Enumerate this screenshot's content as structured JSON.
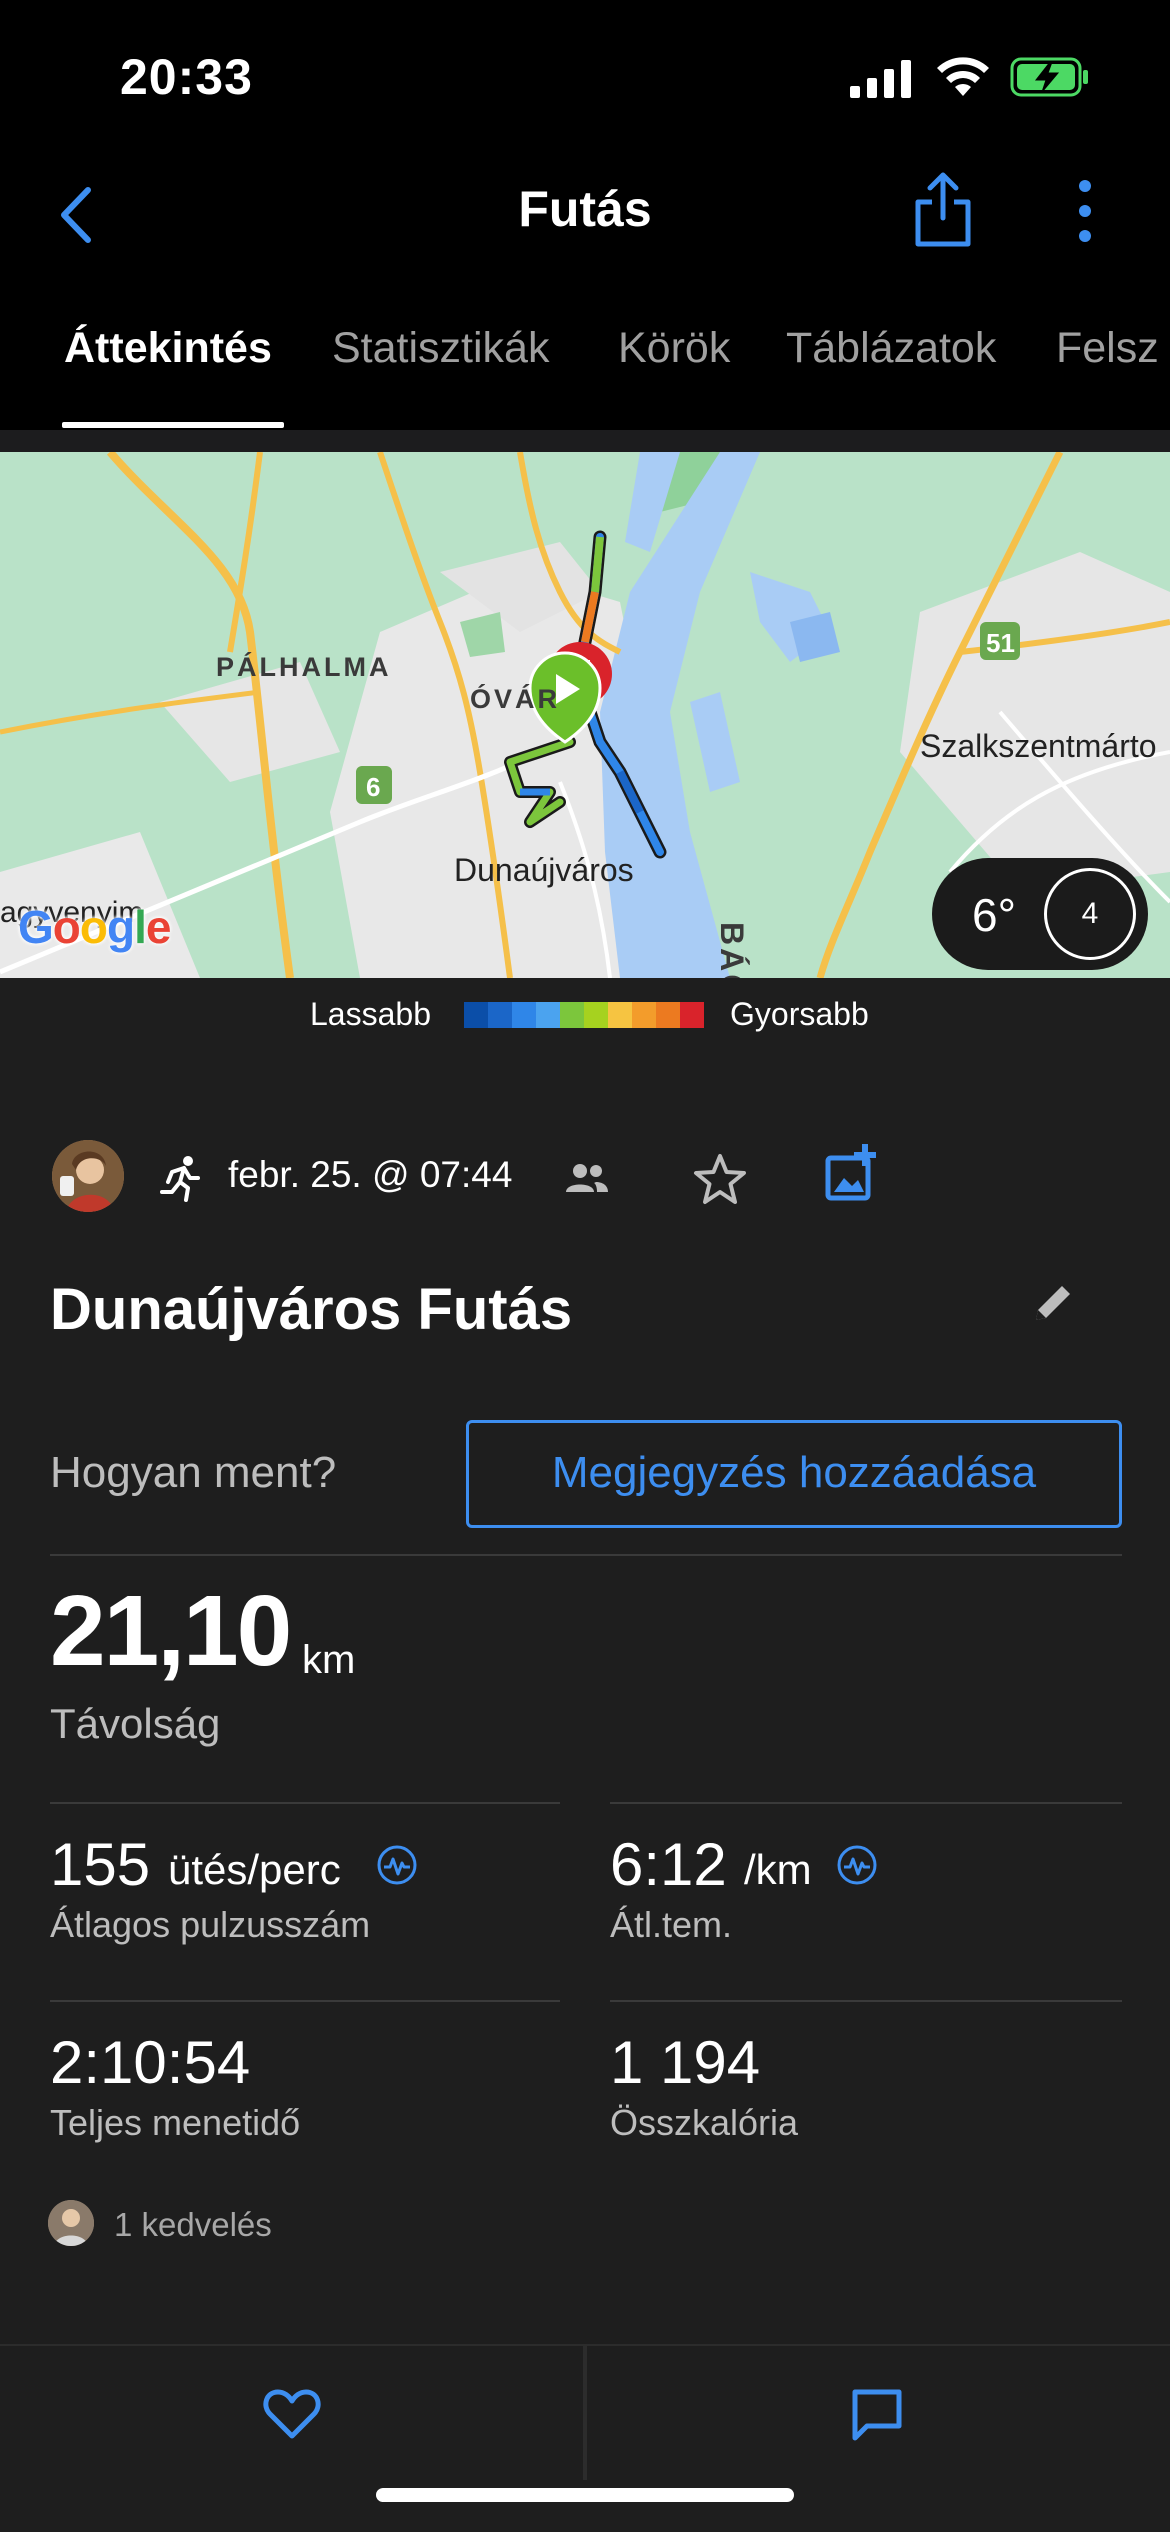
{
  "status_bar": {
    "time": "20:33"
  },
  "nav": {
    "title": "Futás"
  },
  "tabs": [
    {
      "label": "Áttekintés",
      "active": true
    },
    {
      "label": "Statisztikák"
    },
    {
      "label": "Körök"
    },
    {
      "label": "Táblázatok"
    },
    {
      "label": "Felsz"
    }
  ],
  "map": {
    "labels": {
      "palhalma": "PÁLHALMA",
      "ovaros": "ÓVÁR",
      "dunaujvaros": "Dunaújváros",
      "szalk": "Szalkszentmárto",
      "bac": "BÁC",
      "road6": "6",
      "road51": "51",
      "google": "Google",
      "gyorgy": "agyvenyim"
    },
    "weather": {
      "temp": "6°",
      "wind": "4"
    }
  },
  "legend": {
    "slower": "Lassabb",
    "faster": "Gyorsabb",
    "colors": [
      "#0b4ea8",
      "#1b66c8",
      "#2f86e8",
      "#4ba3ef",
      "#7cc63c",
      "#a6d21f",
      "#f6c441",
      "#f39c2b",
      "#ec7a20",
      "#d9232b"
    ]
  },
  "activity": {
    "date": "febr. 25. @ 07:44",
    "title": "Dunaújváros Futás",
    "how_prompt": "Hogyan ment?",
    "add_note": "Megjegyzés hozzáadása"
  },
  "stats": {
    "distance": {
      "value": "21,10",
      "unit": "km",
      "label": "Távolság"
    },
    "hr": {
      "value": "155",
      "unit": "ütés/perc",
      "label": "Átlagos pulzusszám"
    },
    "pace": {
      "value": "6:12",
      "unit": "/km",
      "label": "Átl.tem."
    },
    "time": {
      "value": "2:10:54",
      "label": "Teljes menetidő"
    },
    "calories": {
      "value": "1 194",
      "label": "Összkalória"
    }
  },
  "likes": {
    "text": "1 kedvelés"
  },
  "colors": {
    "accent": "#3d8ef0",
    "background": "#1e1e1e"
  }
}
